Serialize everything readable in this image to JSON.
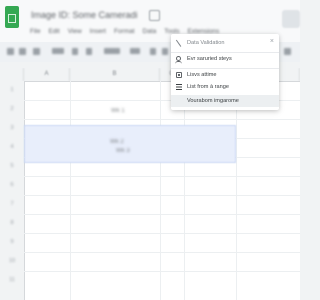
{
  "app": {
    "title": "Image ID: Some Cameradi",
    "menu": [
      "File",
      "Edit",
      "View",
      "Insert",
      "Format",
      "Data",
      "Tools",
      "Extensions"
    ]
  },
  "sheet": {
    "columns": [
      "A",
      "B",
      "C",
      "D",
      "E"
    ],
    "rows": [
      "1",
      "2",
      "3",
      "4",
      "5",
      "6",
      "7",
      "8",
      "9",
      "10",
      "11"
    ],
    "cells": {
      "b3": "Wk 1",
      "b5": "Wk 2",
      "b5b": "Wk 3"
    }
  },
  "dropdown": {
    "close_label": "×",
    "items": [
      {
        "label": "Data Validation",
        "icon": "slash-icon",
        "muted": true
      },
      {
        "label": "Evr saruried steys",
        "icon": "person-icon",
        "muted": false
      },
      {
        "label": "Lisvs attime",
        "icon": "chips-icon",
        "muted": false
      },
      {
        "label": "List from à range",
        "icon": "list-icon",
        "muted": false
      },
      {
        "label": "Vourabom imgarome",
        "icon": "",
        "muted": false
      }
    ],
    "hovered_index": 4
  },
  "colors": {
    "accent": "#35a853",
    "selection": "#e8eefb"
  }
}
